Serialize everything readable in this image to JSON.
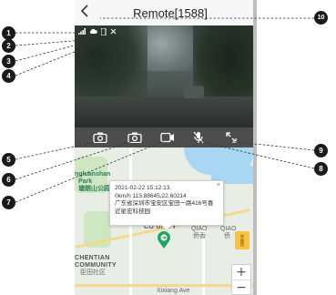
{
  "header": {
    "title": "Remote[1588]",
    "back_icon": "chevron-left-icon"
  },
  "video": {
    "status_icons": [
      "signal-icon",
      "cloud-icon",
      "sd-card-icon",
      "mute-icon"
    ]
  },
  "toolbar": {
    "buttons": [
      {
        "name": "front-snapshot-button",
        "icon": "camera-icon"
      },
      {
        "name": "rear-snapshot-button",
        "icon": "camera-icon"
      },
      {
        "name": "record-button",
        "icon": "video-icon"
      },
      {
        "name": "mic-button",
        "icon": "mic-off-icon"
      },
      {
        "name": "fullscreen-button",
        "icon": "fullscreen-icon"
      }
    ]
  },
  "map": {
    "labels": {
      "park": "ngluanshan",
      "park2": "Park",
      "park_cn": "塘朗山公园",
      "community": "CO  UNITY",
      "qiaoxiang": "QIAO",
      "qiaoxiang_cn": "侨香",
      "qiao_right": "QIAO",
      "qiao_right_cn": "侨",
      "chentian": "CHENTIAN",
      "community2": "COMMUNITY",
      "chentian_cn": "臣田社区",
      "road": "Xixiang Ave"
    },
    "popup": {
      "line1": "2021-02-22 15:12:13.",
      "line2": "0km/h 113.88645,22.60214",
      "line3": "广东省深圳市宝安区宝田一路416号喜",
      "line4": "近星宏科技园",
      "close": "×"
    },
    "zoom_in": "+",
    "zoom_out": "−"
  },
  "callouts": [
    "1",
    "2",
    "3",
    "4",
    "5",
    "6",
    "7",
    "8",
    "9",
    "10"
  ]
}
